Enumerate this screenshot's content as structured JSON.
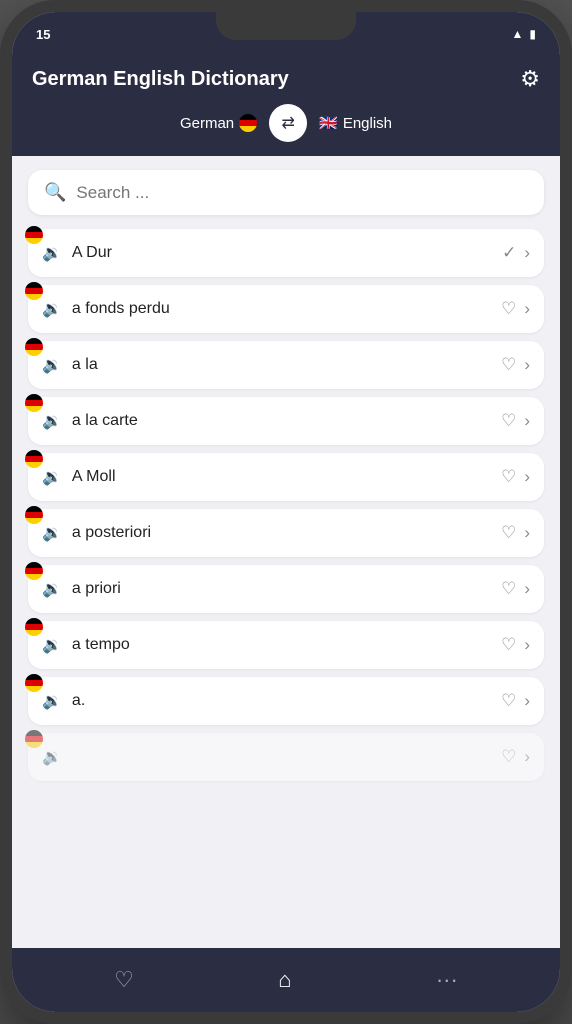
{
  "app": {
    "title": "German English Dictionary",
    "settings_label": "⚙"
  },
  "lang_switcher": {
    "from": "German",
    "to": "English",
    "from_flag": "🇩🇪",
    "to_flag": "🇬🇧",
    "switch_icon": "⇄"
  },
  "search": {
    "placeholder": "Search ..."
  },
  "status_bar": {
    "time": "15",
    "signal": "▲",
    "battery": "■"
  },
  "words": [
    {
      "id": 1,
      "text": "A Dur"
    },
    {
      "id": 2,
      "text": "a fonds perdu"
    },
    {
      "id": 3,
      "text": "a la"
    },
    {
      "id": 4,
      "text": "a la carte"
    },
    {
      "id": 5,
      "text": "A Moll"
    },
    {
      "id": 6,
      "text": "a posteriori"
    },
    {
      "id": 7,
      "text": "a priori"
    },
    {
      "id": 8,
      "text": "a tempo"
    },
    {
      "id": 9,
      "text": "a."
    }
  ],
  "bottom_nav": {
    "items": [
      {
        "id": "favorites",
        "icon": "♡",
        "active": false
      },
      {
        "id": "home",
        "icon": "⌂",
        "active": true
      },
      {
        "id": "more",
        "icon": "⋯",
        "active": false
      }
    ]
  }
}
